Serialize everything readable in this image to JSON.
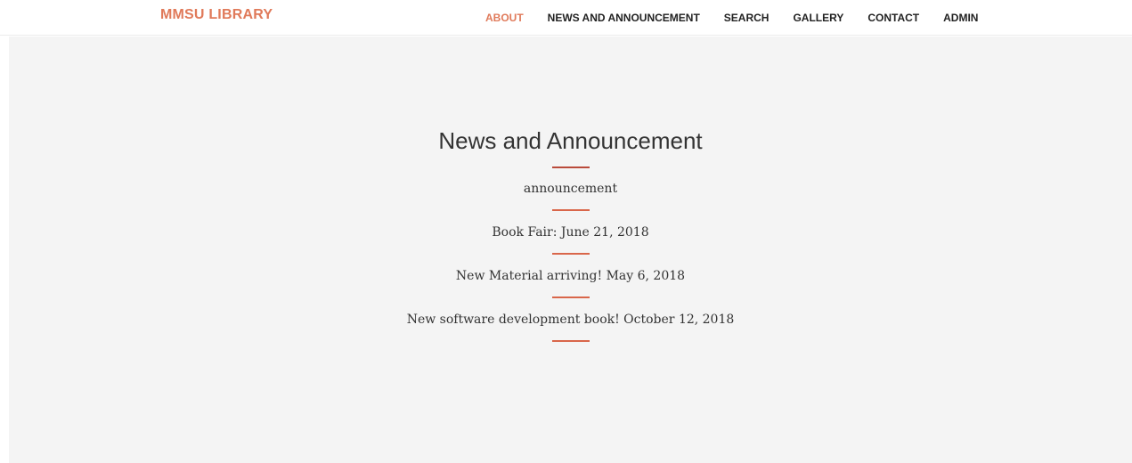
{
  "brand": {
    "name": "MMSU LIBRARY"
  },
  "nav": {
    "items": [
      {
        "label": "ABOUT",
        "active": true
      },
      {
        "label": "NEWS AND ANNOUNCEMENT",
        "active": false
      },
      {
        "label": "SEARCH",
        "active": false
      },
      {
        "label": "GALLERY",
        "active": false
      },
      {
        "label": "CONTACT",
        "active": false
      },
      {
        "label": "ADMIN",
        "active": false
      }
    ]
  },
  "main": {
    "title": "News and Announcement",
    "items": [
      "announcement",
      "Book Fair: June 21, 2018",
      "New Material arriving! May 6, 2018",
      "New software development book! October 12, 2018"
    ]
  },
  "colors": {
    "accent": "#e07a5a",
    "divider": "#d9664a",
    "title_divider": "#b94a3a",
    "background": "#f4f4f4",
    "navbar": "#ffffff"
  }
}
